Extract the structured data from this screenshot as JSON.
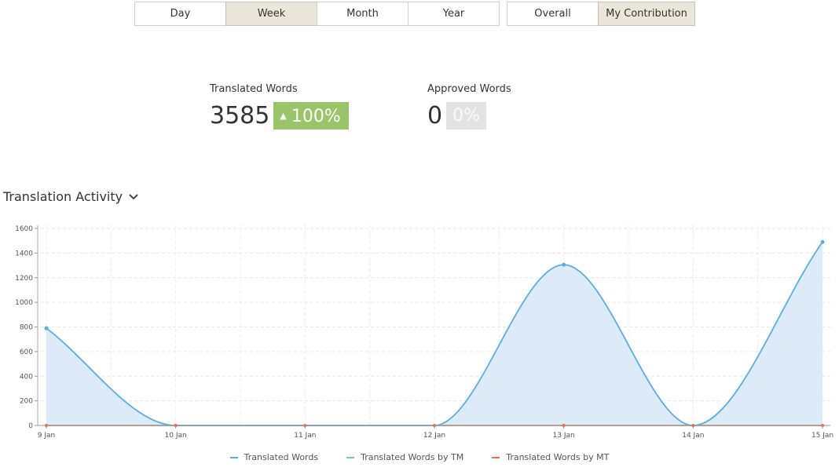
{
  "range_tabs": [
    {
      "label": "Day",
      "active": false
    },
    {
      "label": "Week",
      "active": true
    },
    {
      "label": "Month",
      "active": false
    },
    {
      "label": "Year",
      "active": false
    }
  ],
  "scope_tabs": [
    {
      "label": "Overall",
      "active": false
    },
    {
      "label": "My Contribution",
      "active": true
    }
  ],
  "stats": {
    "translated": {
      "label": "Translated Words",
      "value": "3585",
      "change": "100%",
      "change_icon": "triangle-up-icon"
    },
    "approved": {
      "label": "Approved Words",
      "value": "0",
      "change": "0%"
    }
  },
  "section": {
    "title": "Translation Activity",
    "icon": "chevron-down-icon"
  },
  "colors": {
    "translated": "#5aaddf",
    "tm": "#7cc59a",
    "mt": "#ee6b4d",
    "area": "#dcebf7",
    "badge_up": "#9ac46a"
  },
  "chart_data": {
    "type": "area",
    "categories": [
      "9 Jan",
      "10 Jan",
      "11 Jan",
      "12 Jan",
      "13 Jan",
      "14 Jan",
      "15 Jan"
    ],
    "ylim": [
      0,
      1600
    ],
    "yticks": [
      0,
      200,
      400,
      600,
      800,
      1000,
      1200,
      1400,
      1600
    ],
    "grid": true,
    "legend_position": "bottom",
    "series": [
      {
        "name": "Translated Words",
        "values": [
          790,
          0,
          0,
          0,
          1305,
          0,
          1490
        ]
      },
      {
        "name": "Translated Words by TM",
        "values": [
          0,
          0,
          0,
          0,
          0,
          0,
          0
        ]
      },
      {
        "name": "Translated Words by MT",
        "values": [
          0,
          0,
          0,
          0,
          0,
          0,
          0
        ]
      }
    ]
  }
}
